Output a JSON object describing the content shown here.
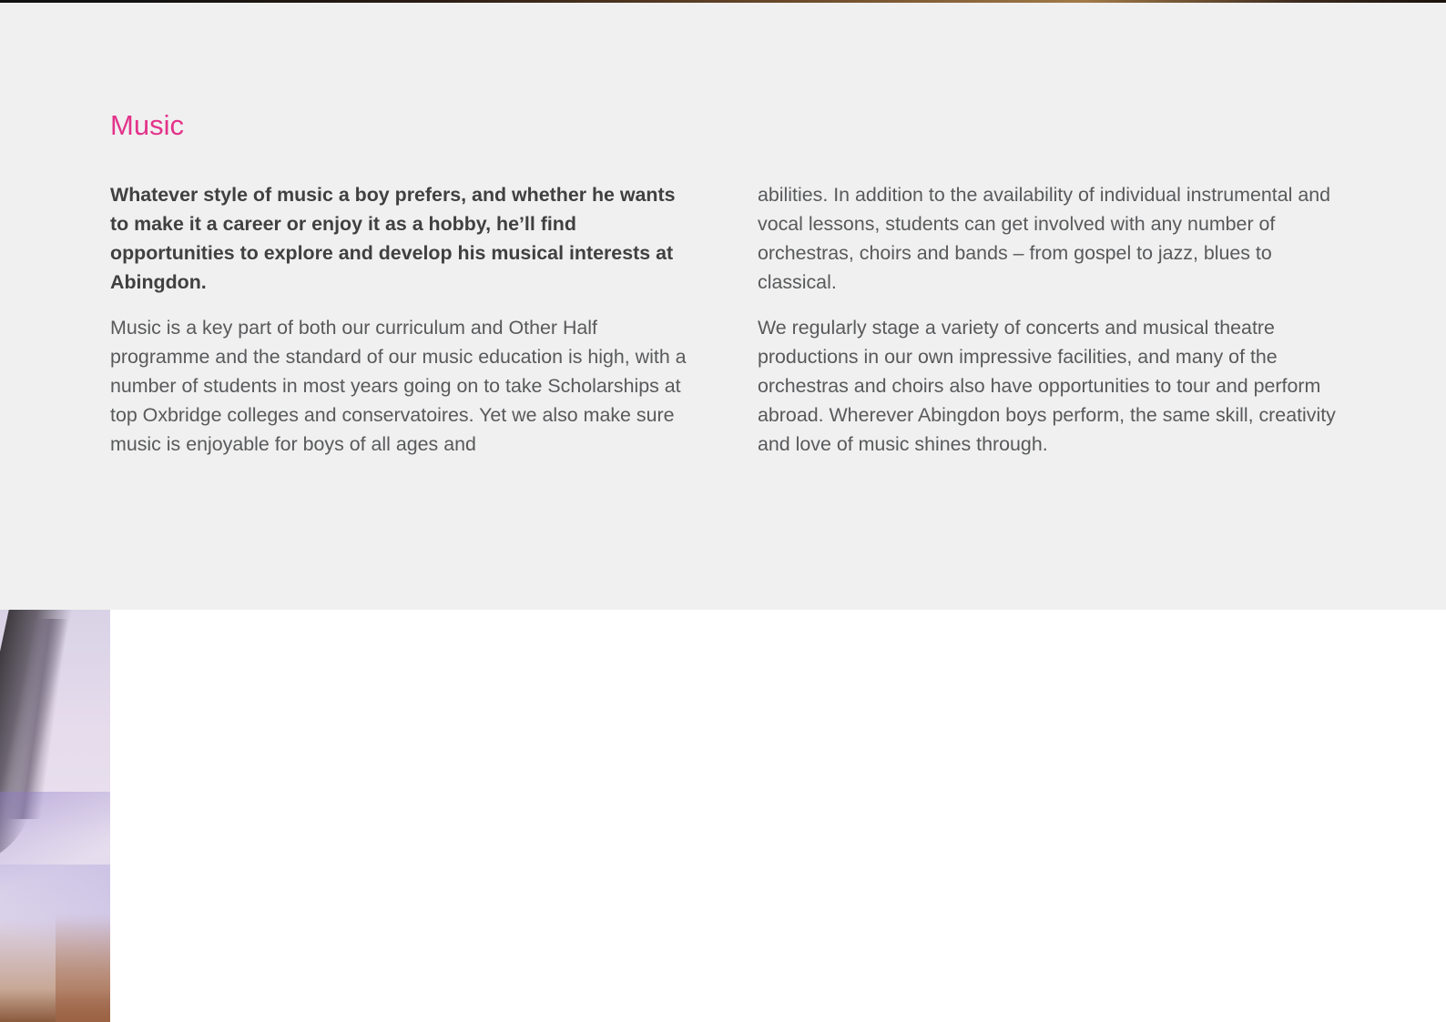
{
  "section": {
    "title": "Music"
  },
  "columns": {
    "left": {
      "lead": "Whatever style of music a boy prefers, and whether he wants to make it a career or enjoy it as a hobby, he’ll find opportunities to explore and develop his musical interests at Abingdon.",
      "body": "Music is a key part of both our curriculum and Other Half programme and the standard of our music education is high, with a number of students in most years going on to take Scholarships at top Oxbridge colleges and conservatoires. Yet we also make sure music is enjoyable for boys of all ages and"
    },
    "right": {
      "para1": "abilities. In addition to the availability of individual instrumental and vocal lessons, students can get involved with any number of orchestras, choirs and bands – from gospel to jazz, blues to classical.",
      "para2": "We regularly stage a variety of concerts and musical theatre productions in our own impressive facilities, and many of the orchestras and choirs also have opportunities to tour and perform abroad. Wherever Abingdon boys perform, the same skill, creativity and love of music shines through."
    }
  },
  "colors": {
    "accent": "#e3338b",
    "panel_background": "#f0f0f0",
    "body_text": "#58595b",
    "lead_text": "#404041"
  }
}
